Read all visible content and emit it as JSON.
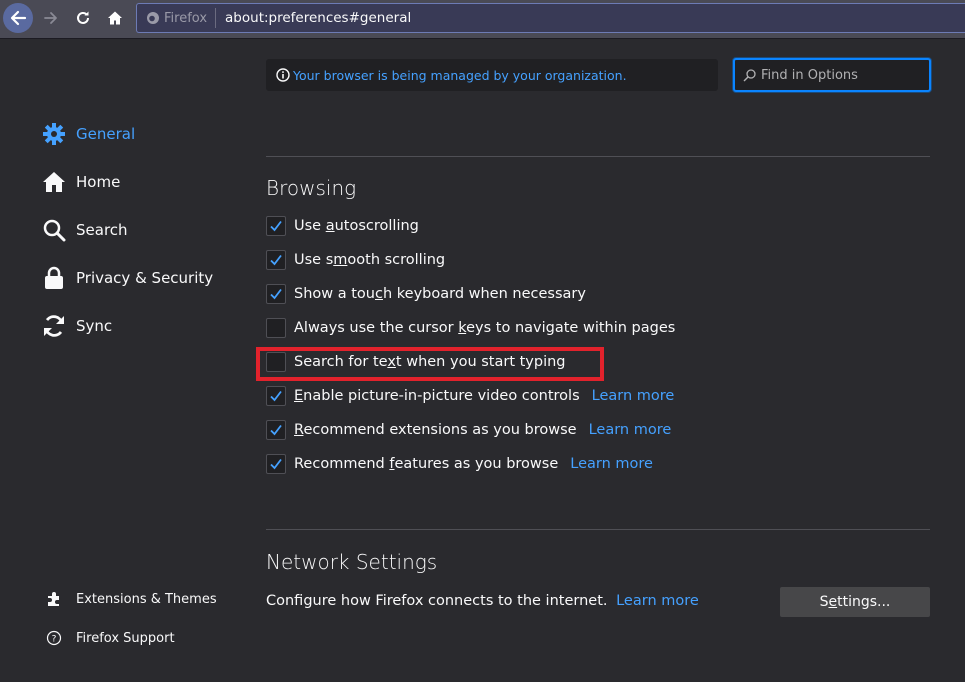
{
  "toolbar": {
    "identity_label": "Firefox",
    "url": "about:preferences#general"
  },
  "notice": {
    "text": "Your browser is being managed by your organization.",
    "icon": "info-icon"
  },
  "search": {
    "placeholder": "Find in Options",
    "icon": "search-icon"
  },
  "sidebar": {
    "items": [
      {
        "label": "General",
        "icon": "gear-icon",
        "active": true
      },
      {
        "label": "Home",
        "icon": "home-icon",
        "active": false
      },
      {
        "label": "Search",
        "icon": "search-icon",
        "active": false
      },
      {
        "label": "Privacy & Security",
        "icon": "lock-icon",
        "active": false
      },
      {
        "label": "Sync",
        "icon": "sync-icon",
        "active": false
      }
    ],
    "footer": [
      {
        "label": "Extensions & Themes",
        "icon": "puzzle-icon"
      },
      {
        "label": "Firefox Support",
        "icon": "help-icon"
      }
    ]
  },
  "browsing": {
    "title": "Browsing",
    "options": [
      {
        "pre": "Use ",
        "key": "a",
        "post": "utoscrolling",
        "checked": true,
        "learn": ""
      },
      {
        "pre": "Use s",
        "key": "m",
        "post": "ooth scrolling",
        "checked": true,
        "learn": ""
      },
      {
        "pre": "Show a tou",
        "key": "c",
        "post": "h keyboard when necessary",
        "checked": true,
        "learn": ""
      },
      {
        "pre": "Always use the cursor ",
        "key": "k",
        "post": "eys to navigate within pages",
        "checked": false,
        "learn": ""
      },
      {
        "pre": "Search for te",
        "key": "x",
        "post": "t when you start typing",
        "checked": false,
        "learn": ""
      },
      {
        "pre": "",
        "key": "E",
        "post": "nable picture-in-picture video controls",
        "checked": true,
        "learn": "Learn more"
      },
      {
        "pre": "",
        "key": "R",
        "post": "ecommend extensions as you browse",
        "checked": true,
        "learn": "Learn more"
      },
      {
        "pre": "Recommend ",
        "key": "f",
        "post": "eatures as you browse",
        "checked": true,
        "learn": "Learn more"
      }
    ]
  },
  "network": {
    "title": "Network Settings",
    "description": "Configure how Firefox connects to the internet.",
    "learn": "Learn more",
    "button_pre": "S",
    "button_key": "e",
    "button_post": "ttings..."
  },
  "colors": {
    "accent": "#45a1ff",
    "focus": "#0a84ff",
    "highlight_box": "#e2222c"
  }
}
